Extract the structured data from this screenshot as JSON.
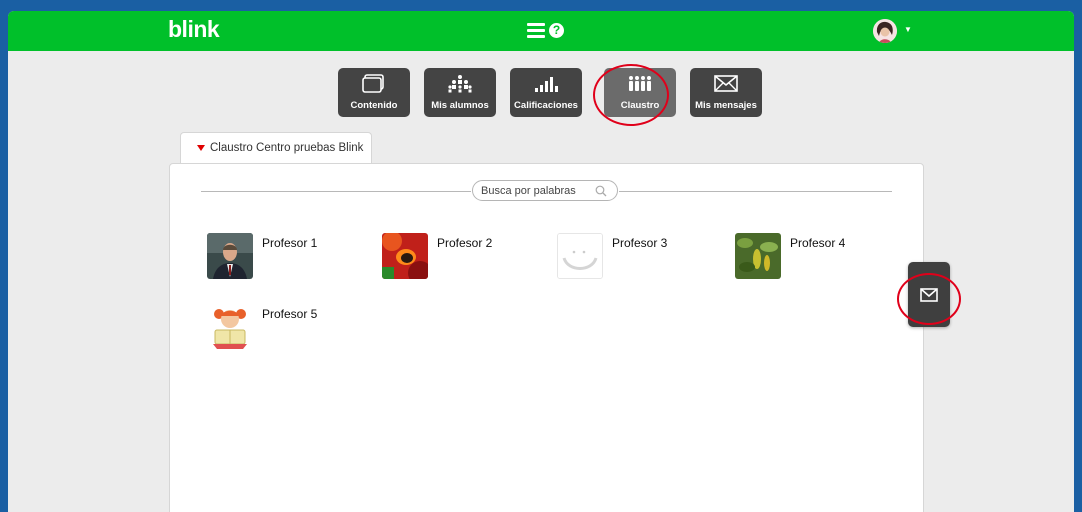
{
  "header": {
    "logo": "blink",
    "help_label": "?"
  },
  "nav": {
    "items": [
      {
        "label": "Contenido",
        "icon": "content-icon"
      },
      {
        "label": "Mis alumnos",
        "icon": "students-icon"
      },
      {
        "label": "Calificaciones",
        "icon": "grades-icon"
      },
      {
        "label": "Claustro",
        "icon": "staff-icon"
      },
      {
        "label": "Mis mensajes",
        "icon": "envelope-icon"
      }
    ],
    "active": "Claustro"
  },
  "tab": {
    "label": "Claustro Centro pruebas Blink"
  },
  "search": {
    "placeholder": "Busca por palabras",
    "value": ""
  },
  "teachers": [
    {
      "name": "Profesor 1"
    },
    {
      "name": "Profesor 2"
    },
    {
      "name": "Profesor 3"
    },
    {
      "name": "Profesor 4"
    },
    {
      "name": "Profesor 5"
    }
  ],
  "colors": {
    "brand_green": "#00c02a",
    "nav_button": "#444444",
    "nav_active": "#6b6b6b",
    "highlight_red": "#e0001a",
    "tab_marker": "#e00000"
  }
}
